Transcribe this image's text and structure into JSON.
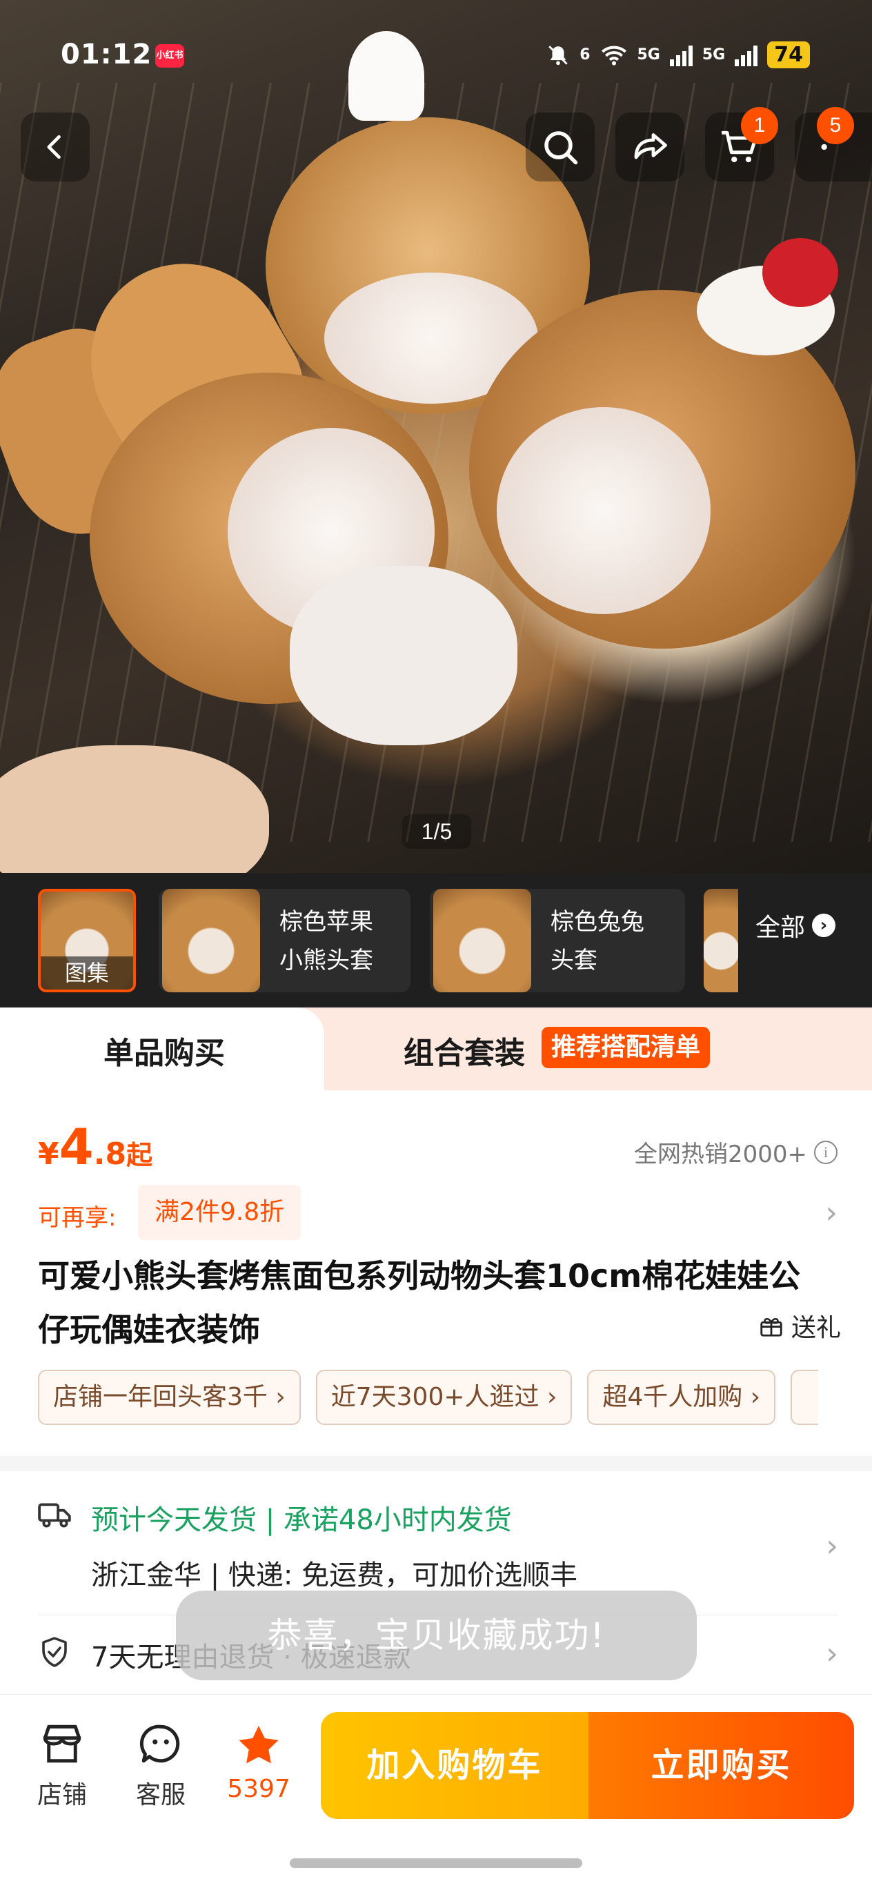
{
  "status_bar": {
    "time": "01:12",
    "app_badge": "小红书",
    "net1": "6",
    "net2": "5G",
    "net3": "5G",
    "battery": "74"
  },
  "nav": {
    "cart_count": "1",
    "more_count": "5"
  },
  "gallery": {
    "pager": "1/5",
    "thumbs": [
      {
        "caption": "图集"
      },
      {
        "label_line1": "棕色苹果",
        "label_line2": "小熊头套"
      },
      {
        "label_line1": "棕色兔兔",
        "label_line2": "头套"
      }
    ],
    "all_label": "全部",
    "all_arrow": "›"
  },
  "tabs": {
    "single": "单品购买",
    "combo": "组合套装",
    "combo_tag": "推荐搭配清单"
  },
  "price": {
    "currency": "¥",
    "integer": "4",
    "decimal": ".8",
    "suffix": "起",
    "hot_sales": "全网热销2000+",
    "info_icon": "i"
  },
  "promo": {
    "label": "可再享:",
    "chip": "满2件9.8折",
    "arrow": "›"
  },
  "product": {
    "title": "可爱小熊头套烤焦面包系列动物头套10cm棉花娃娃公仔玩偶娃衣装饰",
    "gift": "送礼"
  },
  "chips": [
    "店铺一年回头客3千 ›",
    "近7天300+人逛过 ›",
    "超4千人加购 ›"
  ],
  "shipping": {
    "line1": "预计今天发货 | 承诺48小时内发货",
    "line2": "浙江金华 | 快递: 免运费，可加价选顺丰",
    "arrow": "›"
  },
  "guarantee": {
    "text": "7天无理由退货 · 极速退款",
    "arrow": "›"
  },
  "toast": "恭喜，宝贝收藏成功!",
  "bottom_bar": {
    "shop": "店铺",
    "service": "客服",
    "favorites": "5397",
    "add_to_cart": "加入购物车",
    "buy_now": "立即购买"
  },
  "colors": {
    "accent": "#ff5000",
    "cart_button": "#ffb300",
    "shipping_green": "#19a15f"
  }
}
